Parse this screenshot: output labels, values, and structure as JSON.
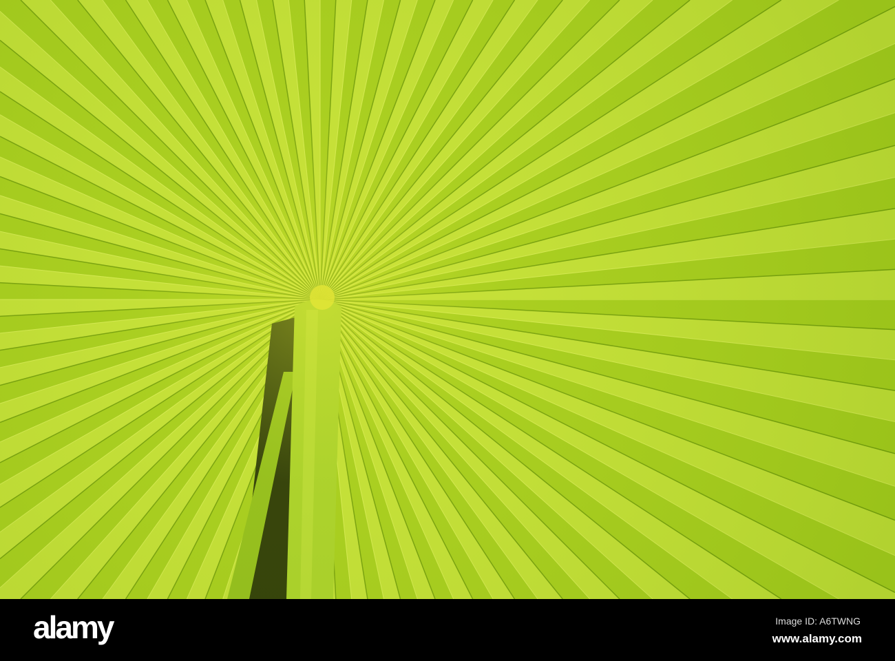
{
  "photo": {
    "colors": {
      "light": "#c4e03a",
      "mid": "#a5cc1e",
      "dark": "#6f9a0c",
      "stem": "#a8d02c",
      "shadow": "#1f2a06"
    }
  },
  "footer": {
    "logo": "alamy",
    "image_id": "Image ID: A6TWNG",
    "site": "www.alamy.com"
  }
}
